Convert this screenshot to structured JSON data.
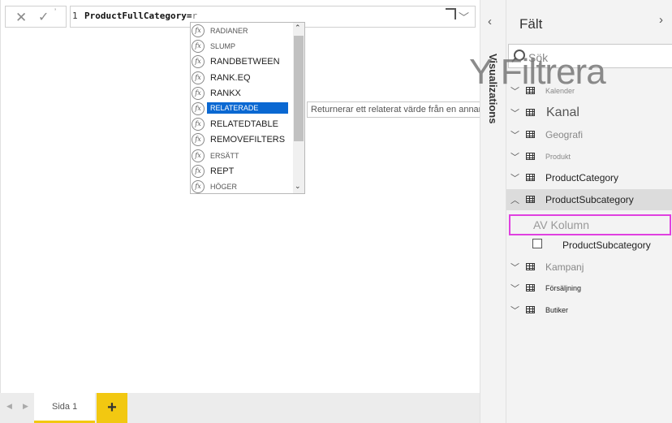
{
  "formula": {
    "line_number": "1",
    "expression": "ProductFullCategory=",
    "typed": "r"
  },
  "suggestions": [
    {
      "label": "RADIANER",
      "style": "small"
    },
    {
      "label": "SLUMP",
      "style": "small"
    },
    {
      "label": "RANDBETWEEN",
      "style": "normal"
    },
    {
      "label": "RANK.EQ",
      "style": "normal"
    },
    {
      "label": "RANKX",
      "style": "normal"
    },
    {
      "label": "RELATERADE",
      "style": "selected"
    },
    {
      "label": "RELATEDTABLE",
      "style": "normal"
    },
    {
      "label": "REMOVEFILTERS",
      "style": "normal"
    },
    {
      "label": "ERSÄTT",
      "style": "small"
    },
    {
      "label": "REPT",
      "style": "normal"
    },
    {
      "label": "HÖGER",
      "style": "small"
    }
  ],
  "tooltip": "Returnerar ett relaterat värde från en annan tabel",
  "pages": {
    "tab_label": "Sida 1",
    "add_label": "+"
  },
  "visualizations": {
    "label": "Visualizations"
  },
  "fields": {
    "title": "Fält",
    "search_placeholder": "Sök",
    "overlay_filter": "Y Filtrera",
    "overlay_kanal": "Kanal",
    "tables": [
      {
        "name": "Kalender",
        "style": "tiny-muted",
        "expanded": false
      },
      {
        "name": "Kanal",
        "style": "hidden",
        "expanded": false
      },
      {
        "name": "Geografi",
        "style": "muted",
        "expanded": false
      },
      {
        "name": "Produkt",
        "style": "tiny-muted",
        "expanded": false
      },
      {
        "name": "ProductCategory",
        "style": "normal",
        "expanded": false
      },
      {
        "name": "ProductSubcategory",
        "style": "active",
        "expanded": true
      },
      {
        "name": "Kampanj",
        "style": "muted",
        "expanded": false
      },
      {
        "name": "Försäljning",
        "style": "tiny",
        "expanded": false
      },
      {
        "name": "Butiker",
        "style": "tiny",
        "expanded": false
      }
    ],
    "new_column": "AV Kolumn",
    "subfield": "ProductSubcategory"
  },
  "colors": {
    "accent_yellow": "#f2c811",
    "selection_blue": "#0a68d2",
    "highlight_magenta": "#e040e0"
  }
}
